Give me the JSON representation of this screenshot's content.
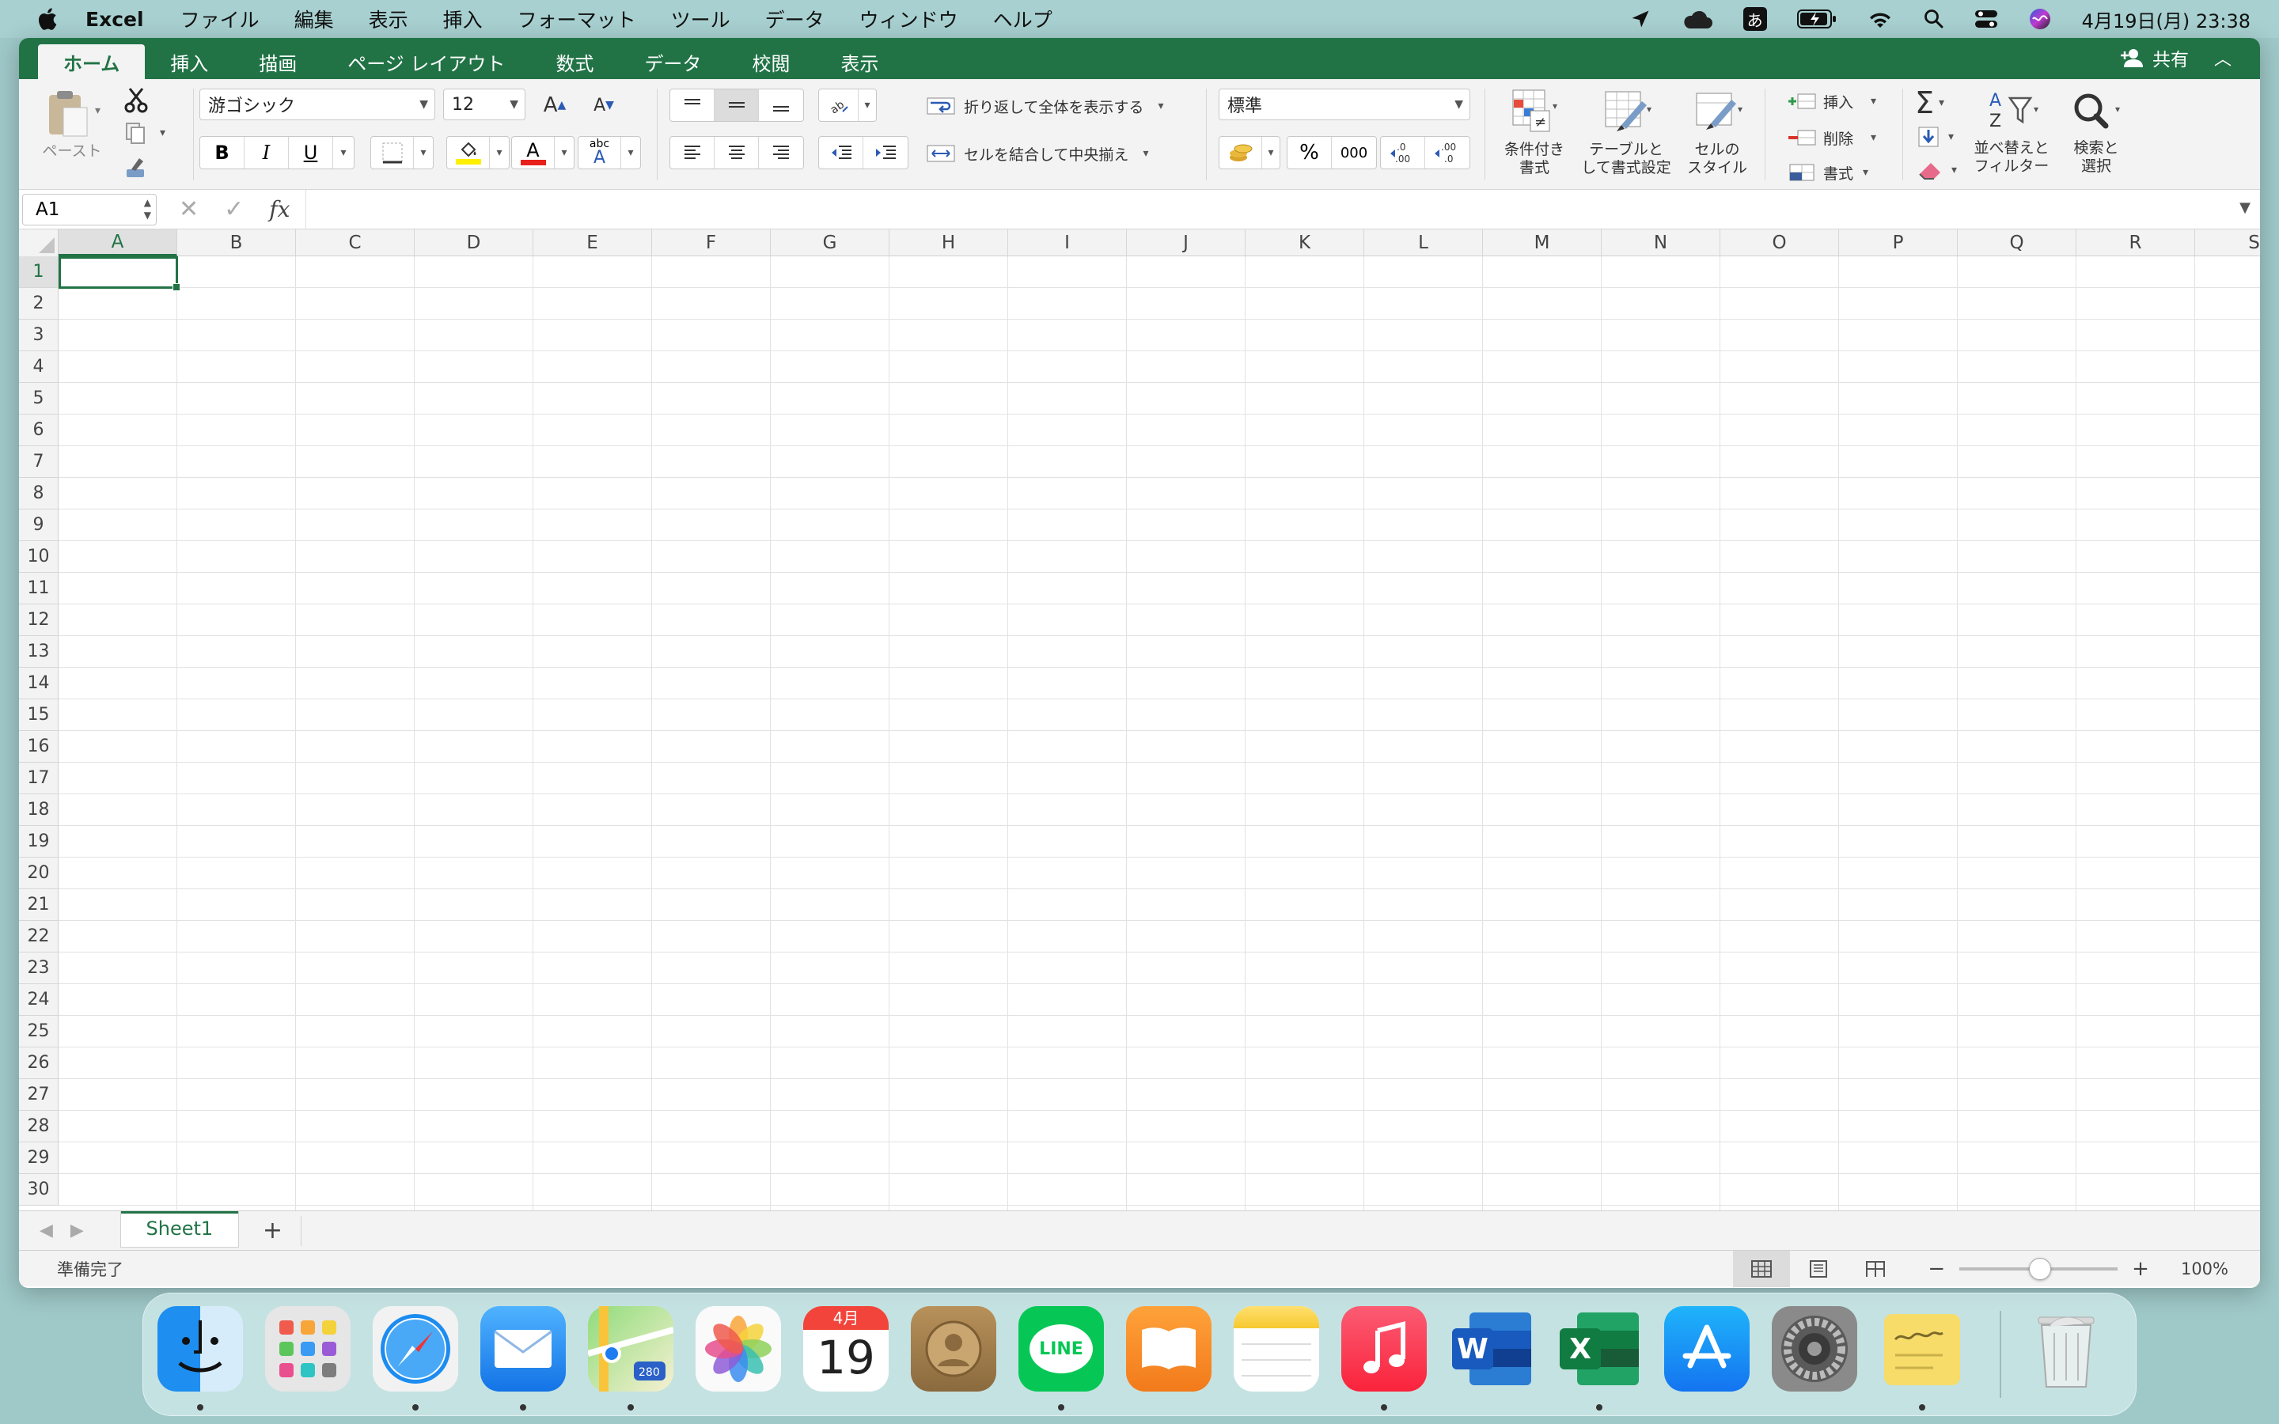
{
  "menubar": {
    "app": "Excel",
    "items": [
      "ファイル",
      "編集",
      "表示",
      "挿入",
      "フォーマット",
      "ツール",
      "データ",
      "ウィンドウ",
      "ヘルプ"
    ],
    "input_method": "あ",
    "clock": "4月19日(月)  23:38"
  },
  "ribbon_tabs": [
    "ホーム",
    "挿入",
    "描画",
    "ページ レイアウト",
    "数式",
    "データ",
    "校閲",
    "表示"
  ],
  "share_label": "共有",
  "ribbon": {
    "paste_label": "ペースト",
    "font_name": "游ゴシック",
    "font_size": "12",
    "bold": "B",
    "italic": "I",
    "underline": "U",
    "wrap_text": "折り返して全体を表示する",
    "merge_center": "セルを結合して中央揃え",
    "number_format": "標準",
    "percent": "%",
    "comma": "000",
    "conditional_format": [
      "条件付き",
      "書式"
    ],
    "format_as_table": [
      "テーブルと",
      "して書式設定"
    ],
    "cell_styles": [
      "セルの",
      "スタイル"
    ],
    "insert": "挿入",
    "delete": "削除",
    "format": "書式",
    "sort_filter": [
      "並べ替えと",
      "フィルター"
    ],
    "find_select": [
      "検索と",
      "選択"
    ]
  },
  "formula_bar": {
    "name_box": "A1",
    "fx": "fx",
    "value": ""
  },
  "grid": {
    "columns": [
      "A",
      "B",
      "C",
      "D",
      "E",
      "F",
      "G",
      "H",
      "I",
      "J",
      "K",
      "L",
      "M",
      "N",
      "O",
      "P",
      "Q",
      "R",
      "S"
    ],
    "rows": [
      "1",
      "2",
      "3",
      "4",
      "5",
      "6",
      "7",
      "8",
      "9",
      "10",
      "11",
      "12",
      "13",
      "14",
      "15",
      "16",
      "17",
      "18",
      "19",
      "20",
      "21",
      "22",
      "23",
      "24",
      "25",
      "26",
      "27",
      "28",
      "29",
      "30"
    ],
    "selected_cell": "A1"
  },
  "sheets": [
    "Sheet1"
  ],
  "status": {
    "text": "準備完了",
    "zoom": "100%"
  },
  "dock": {
    "calendar_month": "4月",
    "calendar_day": "19",
    "line_label": "LINE",
    "word_letter": "W",
    "excel_letter": "X",
    "maps_badge": "280"
  },
  "colors": {
    "excel_green": "#217346",
    "menubar_bg": "#a8d0d0"
  }
}
